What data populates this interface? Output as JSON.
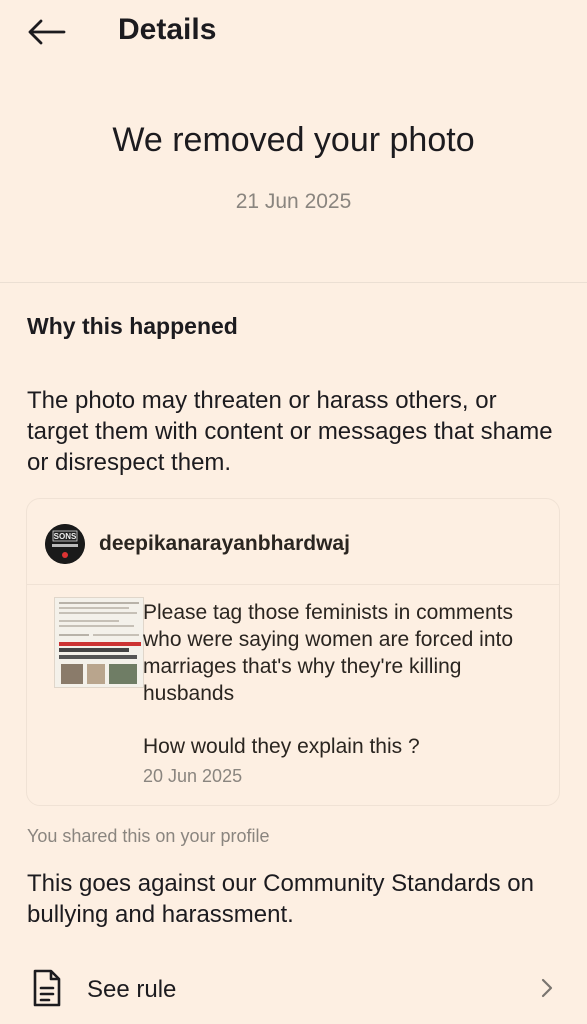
{
  "header": {
    "title": "Details",
    "back_icon": "arrow-left-icon"
  },
  "hero": {
    "title": "We removed your photo",
    "date": "21 Jun 2025"
  },
  "reason_section": {
    "title": "Why this happened",
    "description": "The photo may threaten or harass others, or target them with content or messages that shame or disrespect them."
  },
  "post": {
    "author": "deepikanarayanbhardwaj",
    "avatar_text": "SONS",
    "text": "Please tag those feminists in comments who were saying women are forced into marriages that's why they're killing husbands",
    "question": "How would they explain this ?",
    "date": "20 Jun 2025"
  },
  "shared_note": "You shared this on your profile",
  "standards_text": "This goes against our Community Standards on bullying and harassment.",
  "see_rule": {
    "label": "See rule",
    "icon": "document-icon",
    "chevron": "chevron-right-icon"
  },
  "colors": {
    "background": "#fdefe2",
    "text": "#1c1b1f",
    "muted": "#8a857f"
  }
}
